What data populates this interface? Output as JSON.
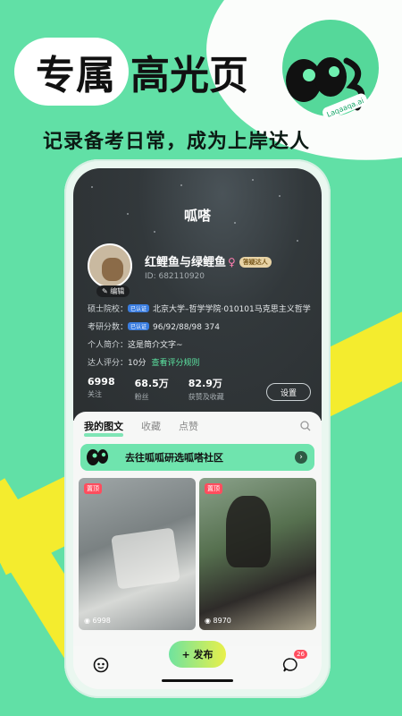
{
  "promo": {
    "headline_part1": "专属",
    "headline_part2": "高光页",
    "subline": "记录备考日常，成为上岸达人",
    "mascot_label": "Laqaaqa.ai"
  },
  "profile": {
    "brand": "呱嗒",
    "nickname": "红鲤鱼与绿鲤鱼",
    "gender_symbol": "♀",
    "level_badge": "答疑达人",
    "edit_label": "编辑",
    "uid": "ID: 682110920",
    "school_label": "硕士院校：",
    "verified_tag": "已认证",
    "school_value": "北京大学–哲学学院·010101马克思主义哲学",
    "score_label": "考研分数：",
    "score_value": "96/92/88/98  374",
    "intro_label": "个人简介：",
    "intro_value": "这是简介文字~",
    "rating_label": "达人评分：",
    "rating_value": "10分",
    "rating_link": "查看评分规则",
    "stats": [
      {
        "num": "6998",
        "label": "关注"
      },
      {
        "num": "68.5万",
        "label": "粉丝"
      },
      {
        "num": "82.9万",
        "label": "获赞及收藏"
      }
    ],
    "settings_label": "设置"
  },
  "tabs": [
    {
      "label": "我的图文"
    },
    {
      "label": "收藏"
    },
    {
      "label": "点赞"
    }
  ],
  "community_banner": "去往呱呱研选呱嗒社区",
  "cards": [
    {
      "pin": "置顶",
      "views": "6998"
    },
    {
      "pin": "置顶",
      "views": "8970"
    }
  ],
  "bottom": {
    "publish_label": "+ 发布",
    "chat_badge": "26"
  },
  "colors": {
    "background": "#61e0a6",
    "accent_yellow": "#f4ec2e",
    "profile_dark": "#2f3436",
    "pin_red": "#ff4d5e"
  }
}
